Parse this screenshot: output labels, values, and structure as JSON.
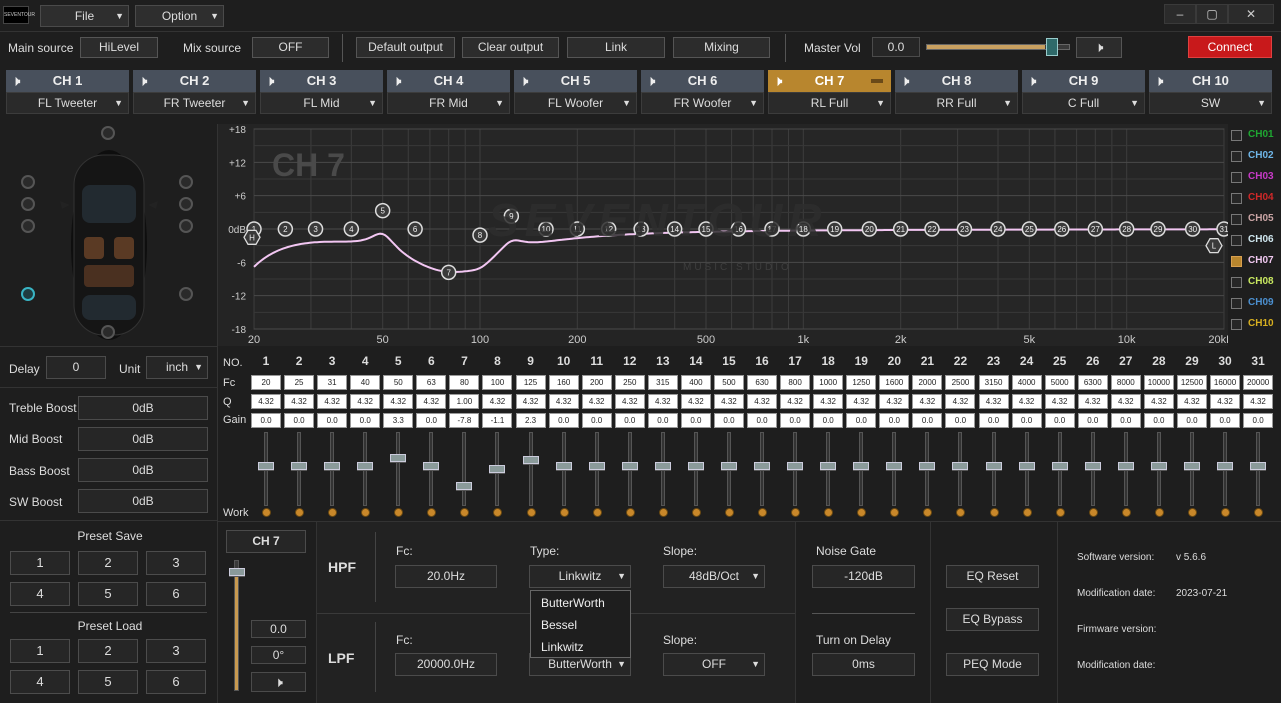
{
  "menu": {
    "file": "File",
    "option": "Option"
  },
  "top": {
    "main_source_label": "Main source",
    "main_source_value": "HiLevel",
    "mix_source_label": "Mix source",
    "mix_source_value": "OFF",
    "default_output": "Default output",
    "clear_output": "Clear output",
    "link": "Link",
    "mixing": "Mixing",
    "master_vol_label": "Master Vol",
    "master_vol_value": "0.0",
    "connect": "Connect"
  },
  "channels": [
    {
      "name": "CH 1",
      "output": "FL Tweeter"
    },
    {
      "name": "CH 2",
      "output": "FR Tweeter"
    },
    {
      "name": "CH 3",
      "output": "FL Mid"
    },
    {
      "name": "CH 4",
      "output": "FR Mid"
    },
    {
      "name": "CH 5",
      "output": "FL Woofer"
    },
    {
      "name": "CH 6",
      "output": "FR Woofer"
    },
    {
      "name": "CH 7",
      "output": "RL Full"
    },
    {
      "name": "CH 8",
      "output": "RR Full"
    },
    {
      "name": "CH 9",
      "output": "C Full"
    },
    {
      "name": "CH 10",
      "output": "SW"
    }
  ],
  "active_channel_index": 6,
  "left": {
    "delay_label": "Delay",
    "delay_value": "0",
    "unit_label": "Unit",
    "unit_value": "inch",
    "treble_label": "Treble Boost",
    "treble_value": "0dB",
    "mid_label": "Mid Boost",
    "mid_value": "0dB",
    "bass_label": "Bass Boost",
    "bass_value": "0dB",
    "sw_label": "SW Boost",
    "sw_value": "0dB",
    "preset_save_label": "Preset Save",
    "preset_load_label": "Preset Load",
    "presets": [
      "1",
      "2",
      "3",
      "4",
      "5",
      "6"
    ]
  },
  "graph": {
    "channel_title": "CH 7",
    "watermark": "SEVENTOUR",
    "watermark_sub": "MUSIC STUDIO",
    "y_ticks": [
      "+18",
      "+12",
      "+6",
      "0dB",
      "-6",
      "-12",
      "-18"
    ],
    "x_ticks": [
      "20",
      "50",
      "100",
      "200",
      "500",
      "1k",
      "2k",
      "5k",
      "10k",
      "20kHz"
    ],
    "legend": [
      {
        "name": "CH01",
        "color": "#1fa832",
        "checked": false
      },
      {
        "name": "CH02",
        "color": "#6fb6e8",
        "checked": false
      },
      {
        "name": "CH03",
        "color": "#c83ac8",
        "checked": false
      },
      {
        "name": "CH04",
        "color": "#d02828",
        "checked": false
      },
      {
        "name": "CH05",
        "color": "#c9a4a4",
        "checked": false
      },
      {
        "name": "CH06",
        "color": "#cfe6ee",
        "checked": false
      },
      {
        "name": "CH07",
        "color": "#f0c8f0",
        "checked": true
      },
      {
        "name": "CH08",
        "color": "#c8e860",
        "checked": false
      },
      {
        "name": "CH09",
        "color": "#4c90d0",
        "checked": false
      },
      {
        "name": "CH10",
        "color": "#d8b020",
        "checked": false
      }
    ],
    "hp_marker": "H",
    "lp_marker": "L"
  },
  "eq": {
    "row_labels": {
      "no": "NO.",
      "fc": "Fc",
      "q": "Q",
      "gain": "Gain",
      "work": "Work"
    },
    "bands": [
      {
        "no": "1",
        "fc": "20",
        "q": "4.32",
        "gain": "0.0"
      },
      {
        "no": "2",
        "fc": "25",
        "q": "4.32",
        "gain": "0.0"
      },
      {
        "no": "3",
        "fc": "31",
        "q": "4.32",
        "gain": "0.0"
      },
      {
        "no": "4",
        "fc": "40",
        "q": "4.32",
        "gain": "0.0"
      },
      {
        "no": "5",
        "fc": "50",
        "q": "4.32",
        "gain": "3.3"
      },
      {
        "no": "6",
        "fc": "63",
        "q": "4.32",
        "gain": "0.0"
      },
      {
        "no": "7",
        "fc": "80",
        "q": "1.00",
        "gain": "-7.8"
      },
      {
        "no": "8",
        "fc": "100",
        "q": "4.32",
        "gain": "-1.1"
      },
      {
        "no": "9",
        "fc": "125",
        "q": "4.32",
        "gain": "2.3"
      },
      {
        "no": "10",
        "fc": "160",
        "q": "4.32",
        "gain": "0.0"
      },
      {
        "no": "11",
        "fc": "200",
        "q": "4.32",
        "gain": "0.0"
      },
      {
        "no": "12",
        "fc": "250",
        "q": "4.32",
        "gain": "0.0"
      },
      {
        "no": "13",
        "fc": "315",
        "q": "4.32",
        "gain": "0.0"
      },
      {
        "no": "14",
        "fc": "400",
        "q": "4.32",
        "gain": "0.0"
      },
      {
        "no": "15",
        "fc": "500",
        "q": "4.32",
        "gain": "0.0"
      },
      {
        "no": "16",
        "fc": "630",
        "q": "4.32",
        "gain": "0.0"
      },
      {
        "no": "17",
        "fc": "800",
        "q": "4.32",
        "gain": "0.0"
      },
      {
        "no": "18",
        "fc": "1000",
        "q": "4.32",
        "gain": "0.0"
      },
      {
        "no": "19",
        "fc": "1250",
        "q": "4.32",
        "gain": "0.0"
      },
      {
        "no": "20",
        "fc": "1600",
        "q": "4.32",
        "gain": "0.0"
      },
      {
        "no": "21",
        "fc": "2000",
        "q": "4.32",
        "gain": "0.0"
      },
      {
        "no": "22",
        "fc": "2500",
        "q": "4.32",
        "gain": "0.0"
      },
      {
        "no": "23",
        "fc": "3150",
        "q": "4.32",
        "gain": "0.0"
      },
      {
        "no": "24",
        "fc": "4000",
        "q": "4.32",
        "gain": "0.0"
      },
      {
        "no": "25",
        "fc": "5000",
        "q": "4.32",
        "gain": "0.0"
      },
      {
        "no": "26",
        "fc": "6300",
        "q": "4.32",
        "gain": "0.0"
      },
      {
        "no": "27",
        "fc": "8000",
        "q": "4.32",
        "gain": "0.0"
      },
      {
        "no": "28",
        "fc": "10000",
        "q": "4.32",
        "gain": "0.0"
      },
      {
        "no": "29",
        "fc": "12500",
        "q": "4.32",
        "gain": "0.0"
      },
      {
        "no": "30",
        "fc": "16000",
        "q": "4.32",
        "gain": "0.0"
      },
      {
        "no": "31",
        "fc": "20000",
        "q": "4.32",
        "gain": "0.0"
      }
    ]
  },
  "bottom": {
    "ch_label": "CH 7",
    "vol_value": "0.0",
    "phase_value": "0°",
    "hpf_label": "HPF",
    "lpf_label": "LPF",
    "fc_label": "Fc:",
    "type_label": "Type:",
    "slope_label": "Slope:",
    "hpf_fc": "20.0Hz",
    "hpf_type": "Linkwitz",
    "hpf_slope": "48dB/Oct",
    "lpf_fc": "20000.0Hz",
    "lpf_type": "ButterWorth",
    "lpf_slope": "OFF",
    "type_options": [
      "ButterWorth",
      "Bessel",
      "Linkwitz"
    ],
    "noise_gate_label": "Noise Gate",
    "noise_gate_value": "-120dB",
    "turn_on_delay_label": "Turn on Delay",
    "turn_on_delay_value": "0ms",
    "eq_reset": "EQ Reset",
    "eq_bypass": "EQ Bypass",
    "peq_mode": "PEQ Mode",
    "software_version_label": "Software version:",
    "software_version": "v 5.6.6",
    "mod_date_label": "Modification date:",
    "mod_date": "2023-07-21",
    "firmware_version_label": "Firmware version:",
    "firmware_version": "",
    "mod_date2_label": "Modification date:",
    "mod_date2": ""
  }
}
